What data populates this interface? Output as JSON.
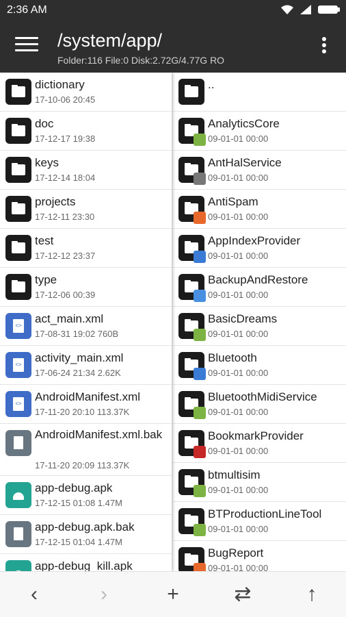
{
  "status": {
    "time": "2:36",
    "ampm": "AM"
  },
  "appbar": {
    "path": "/system/app/",
    "info": "Folder:116 File:0  Disk:2.72G/4.77G  RO"
  },
  "left_pane": [
    {
      "name": "dictionary",
      "meta": "17-10-06 20:45",
      "type": "folder"
    },
    {
      "name": "doc",
      "meta": "17-12-17 19:38",
      "type": "folder"
    },
    {
      "name": "keys",
      "meta": "17-12-14 18:04",
      "type": "folder"
    },
    {
      "name": "projects",
      "meta": "17-12-11 23:30",
      "type": "folder"
    },
    {
      "name": "test",
      "meta": "17-12-12 23:37",
      "type": "folder"
    },
    {
      "name": "type",
      "meta": "17-12-06 00:39",
      "type": "folder"
    },
    {
      "name": "act_main.xml",
      "meta": "17-08-31 19:02   760B",
      "type": "xml"
    },
    {
      "name": "activity_main.xml",
      "meta": "17-06-24 21:34   2.62K",
      "type": "xml"
    },
    {
      "name": "AndroidManifest.xml",
      "meta": "17-11-20 20:10   113.37K",
      "type": "xml"
    },
    {
      "name": "AndroidManifest.xml.bak",
      "meta": "17-11-20 20:09   113.37K",
      "type": "file"
    },
    {
      "name": "app-debug.apk",
      "meta": "17-12-15 01:08   1.47M",
      "type": "apk"
    },
    {
      "name": "app-debug.apk.bak",
      "meta": "17-12-15 01:04   1.47M",
      "type": "apkbak"
    },
    {
      "name": "app-debug_kill.apk",
      "meta": "",
      "type": "apk"
    }
  ],
  "right_pane": [
    {
      "name": "..",
      "meta": "",
      "badge": ""
    },
    {
      "name": "AnalyticsCore",
      "meta": "09-01-01 00:00",
      "badge": "green"
    },
    {
      "name": "AntHalService",
      "meta": "09-01-01 00:00",
      "badge": "grey"
    },
    {
      "name": "AntiSpam",
      "meta": "09-01-01 00:00",
      "badge": "orange"
    },
    {
      "name": "AppIndexProvider",
      "meta": "09-01-01 00:00",
      "badge": "blue"
    },
    {
      "name": "BackupAndRestore",
      "meta": "09-01-01 00:00",
      "badge": "lightblue"
    },
    {
      "name": "BasicDreams",
      "meta": "09-01-01 00:00",
      "badge": "green"
    },
    {
      "name": "Bluetooth",
      "meta": "09-01-01 00:00",
      "badge": "blue"
    },
    {
      "name": "BluetoothMidiService",
      "meta": "09-01-01 00:00",
      "badge": "green"
    },
    {
      "name": "BookmarkProvider",
      "meta": "09-01-01 00:00",
      "badge": "red"
    },
    {
      "name": "btmultisim",
      "meta": "09-01-01 00:00",
      "badge": "green"
    },
    {
      "name": "BTProductionLineTool",
      "meta": "09-01-01 00:00",
      "badge": "green"
    },
    {
      "name": "BugReport",
      "meta": "09-01-01 00:00",
      "badge": "orange"
    }
  ],
  "bottombar": {
    "back": "‹",
    "forward": "›",
    "add": "+",
    "swap": "⇄",
    "up": "↑"
  }
}
